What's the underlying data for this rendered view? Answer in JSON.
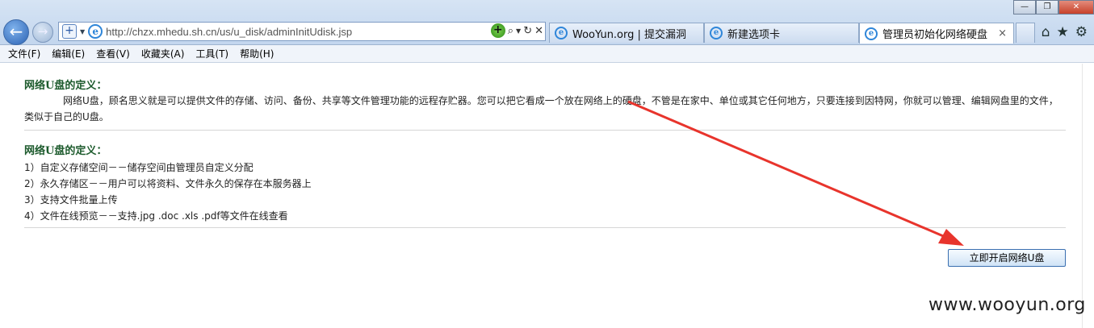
{
  "browser": {
    "url": "http://chzx.mhedu.sh.cn/us/u_disk/adminInitUdisk.jsp",
    "tabs": [
      {
        "label": "WooYun.org | 提交漏洞"
      },
      {
        "label": "新建选项卡"
      },
      {
        "label": "管理员初始化网络硬盘",
        "close": "×"
      }
    ],
    "window_controls": {
      "minimize": "—",
      "maximize": "❐",
      "close": "✕"
    }
  },
  "menu": [
    "文件(F)",
    "编辑(E)",
    "查看(V)",
    "收藏夹(A)",
    "工具(T)",
    "帮助(H)"
  ],
  "page": {
    "section1": {
      "title": "网络U盘的定义：",
      "body": "网络U盘，顾名思义就是可以提供文件的存储、访问、备份、共享等文件管理功能的远程存贮器。您可以把它看成一个放在网络上的硬盘，不管是在家中、单位或其它任何地方，只要连接到因特网，你就可以管理、编辑网盘里的文件，类似于自己的U盘。"
    },
    "section2": {
      "title": "网络U盘的定义：",
      "features": [
        "1）自定义存储空间－－储存空间由管理员自定义分配",
        "2）永久存储区－－用户可以将资料、文件永久的保存在本服务器上",
        "3）支持文件批量上传",
        "4）文件在线预览－－支持.jpg .doc .xls .pdf等文件在线查看"
      ]
    },
    "open_button": "立即开启网络U盘"
  },
  "watermark": "www.wooyun.org",
  "annotation": {
    "color": "#e8342c"
  }
}
